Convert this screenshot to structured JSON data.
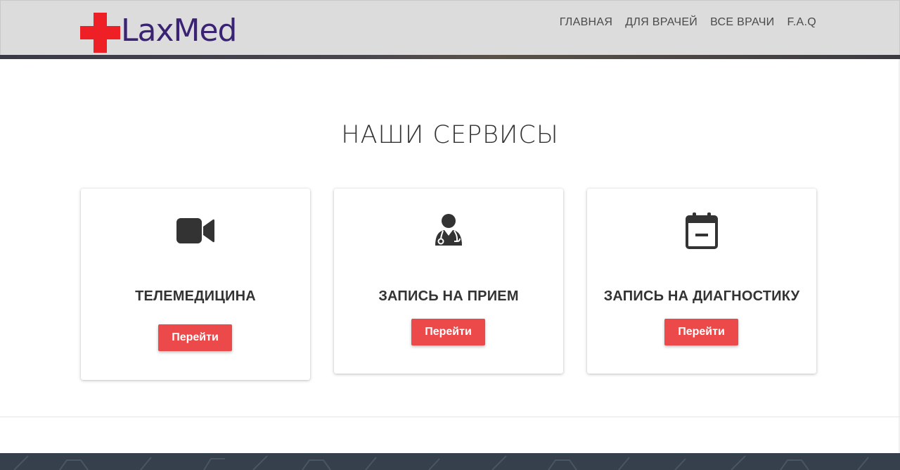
{
  "header": {
    "logo_text": "LaxMed",
    "logo_icon": "red-cross-icon",
    "nav": [
      {
        "label": "ГЛАВНАЯ"
      },
      {
        "label": "ДЛЯ ВРАЧЕЙ"
      },
      {
        "label": "ВСЕ ВРАЧИ"
      },
      {
        "label": "F.A.Q"
      }
    ]
  },
  "main": {
    "title": "НАШИ СЕРВИСЫ",
    "cards": [
      {
        "icon": "video-camera-icon",
        "title": "ТЕЛЕМЕДИЦИНА",
        "button": "Перейти"
      },
      {
        "icon": "doctor-icon",
        "title": "ЗАПИСЬ НА ПРИЕМ",
        "button": "Перейти"
      },
      {
        "icon": "calendar-icon",
        "title": "ЗАПИСЬ НА ДИАГНОСТИКУ",
        "button": "Перейти"
      }
    ]
  },
  "colors": {
    "brand_red": "#ee1f25",
    "brand_purple": "#3b2373",
    "button_red": "#ec4a4a",
    "header_bg": "#dcdcdc",
    "footer_bg": "#36404c"
  }
}
